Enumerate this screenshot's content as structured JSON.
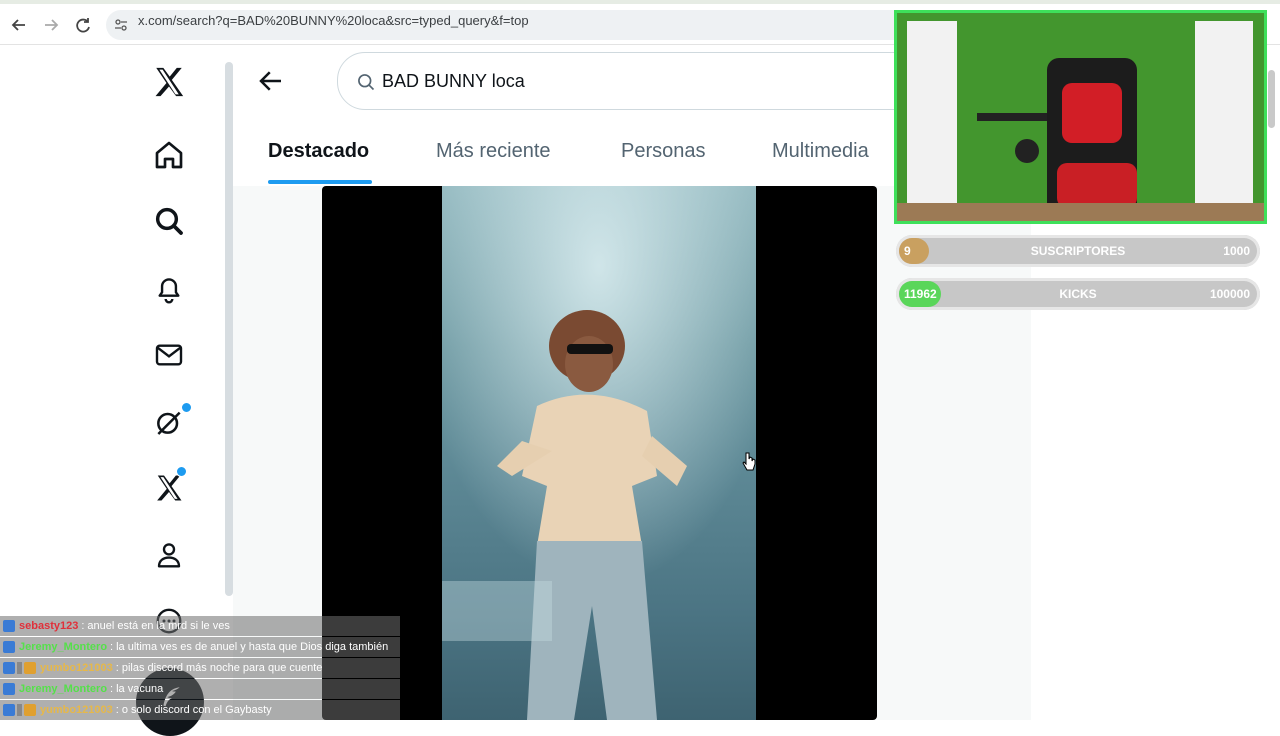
{
  "browser": {
    "url": "x.com/search?q=BAD%20BUNNY%20loca&src=typed_query&f=top",
    "back_icon": "arrow-left",
    "forward_icon": "arrow-right",
    "reload_icon": "reload"
  },
  "search": {
    "query": "BAD BUNNY loca"
  },
  "tabs": [
    {
      "label": "Destacado",
      "active": true
    },
    {
      "label": "Más reciente",
      "active": false
    },
    {
      "label": "Personas",
      "active": false
    },
    {
      "label": "Multimedia",
      "active": false
    }
  ],
  "sidebar": {
    "items": [
      {
        "name": "x-logo"
      },
      {
        "name": "home-icon"
      },
      {
        "name": "explore-icon"
      },
      {
        "name": "notifications-icon"
      },
      {
        "name": "messages-icon"
      },
      {
        "name": "grok-icon"
      },
      {
        "name": "premium-icon"
      },
      {
        "name": "profile-icon"
      },
      {
        "name": "more-icon"
      }
    ],
    "accent": "#1d9bf0"
  },
  "goals": [
    {
      "current": "9",
      "label": "SUSCRIPTORES",
      "target": "1000",
      "progress": 0.009,
      "color": "#c9a060"
    },
    {
      "current": "11962",
      "label": "KICKS",
      "target": "100000",
      "progress": 0.12,
      "color": "#5ad65a"
    }
  ],
  "chat": [
    {
      "user": "sebasty123",
      "color": "#e0303a",
      "text": "anuel está en la mrd si le ves",
      "badges": 1
    },
    {
      "user": "Jeremy_Montero",
      "color": "#55e04a",
      "text": "la ultima ves es de anuel y hasta que Dios diga también",
      "badges": 1
    },
    {
      "user": "yumbo121003",
      "color": "#e6b84a",
      "text": "pilas discord más noche para que cuente",
      "badges": 3
    },
    {
      "user": "Jeremy_Montero",
      "color": "#55e04a",
      "text": "la vacuna",
      "badges": 1
    },
    {
      "user": "yumbo121003",
      "color": "#e6b84a",
      "text": "o solo discord con el Gaybasty",
      "badges": 3
    }
  ]
}
